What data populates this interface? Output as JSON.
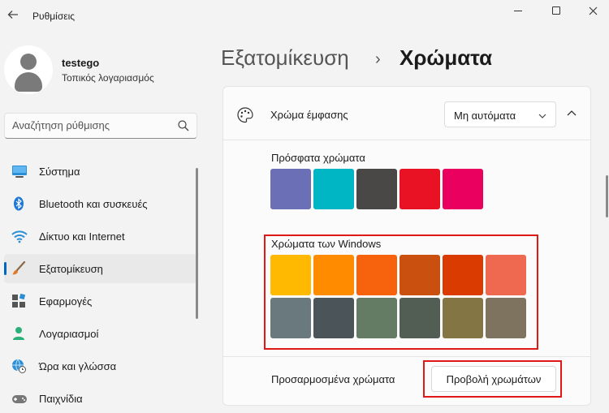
{
  "window": {
    "title": "Ρυθμίσεις",
    "back_icon": "back-arrow-icon",
    "controls": [
      "minimize-icon",
      "maximize-icon",
      "close-icon"
    ]
  },
  "user": {
    "name": "testego",
    "account_type": "Τοπικός λογαριασμός"
  },
  "search": {
    "placeholder": "Αναζήτηση ρύθμισης",
    "value": "",
    "icon": "search-icon"
  },
  "nav": {
    "items": [
      {
        "label": "Σύστημα",
        "icon": "system-icon",
        "selected": false
      },
      {
        "label": "Bluetooth και συσκευές",
        "icon": "bluetooth-icon",
        "selected": false
      },
      {
        "label": "Δίκτυο και Internet",
        "icon": "wifi-icon",
        "selected": false
      },
      {
        "label": "Εξατομίκευση",
        "icon": "brush-icon",
        "selected": true
      },
      {
        "label": "Εφαρμογές",
        "icon": "apps-icon",
        "selected": false
      },
      {
        "label": "Λογαριασμοί",
        "icon": "account-icon",
        "selected": false
      },
      {
        "label": "Ώρα και γλώσσα",
        "icon": "globe-clock-icon",
        "selected": false
      },
      {
        "label": "Παιχνίδια",
        "icon": "gamepad-icon",
        "selected": false
      }
    ]
  },
  "header": {
    "breadcrumb": "Εξατομίκευση",
    "separator": "›",
    "title": "Χρώματα"
  },
  "accent": {
    "label": "Χρώμα έμφασης",
    "icon": "palette-icon",
    "dropdown_value": "Μη αυτόματα",
    "dropdown_icon": "chevron-down-icon",
    "collapse_icon": "chevron-up-icon"
  },
  "recent": {
    "label": "Πρόσφατα χρώματα",
    "colors": [
      "#6b6fb5",
      "#00b5c4",
      "#4a4847",
      "#e81224",
      "#ea005e"
    ]
  },
  "windows_colors": {
    "label": "Χρώματα των Windows",
    "rows": [
      [
        "#ffb900",
        "#ff8c00",
        "#f7630c",
        "#ca5010",
        "#da3b01",
        "#ef6950"
      ],
      [
        "#69797e",
        "#4a5459",
        "#647c64",
        "#525e54",
        "#847545",
        "#7e735f"
      ]
    ]
  },
  "custom": {
    "label": "Προσαρμοσμένα χρώματα",
    "button": "Προβολή χρωμάτων"
  },
  "colors": {
    "highlight": "#e01818",
    "accent": "#0067c0"
  }
}
